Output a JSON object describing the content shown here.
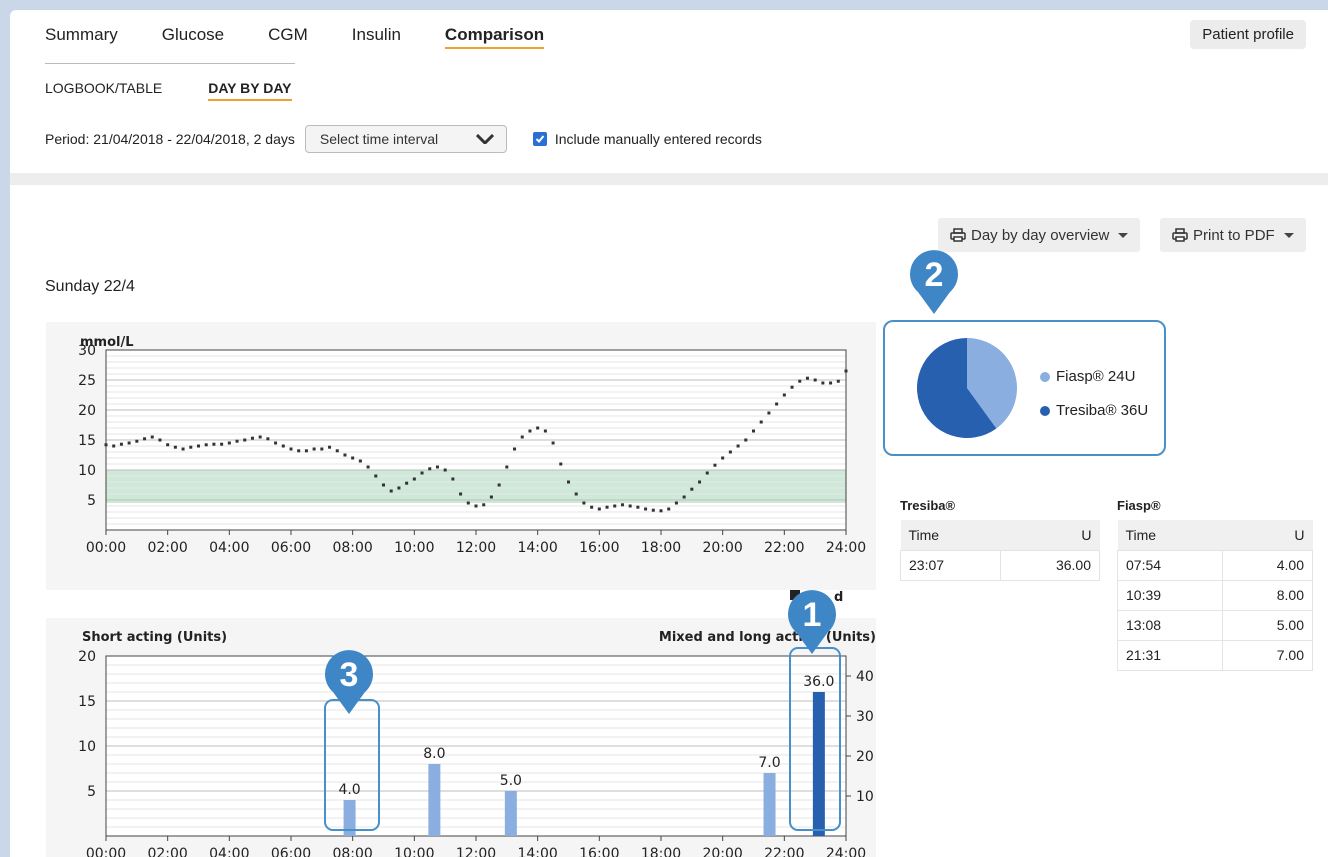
{
  "tabs": [
    "Summary",
    "Glucose",
    "CGM",
    "Insulin",
    "Comparison"
  ],
  "active_tab": "Comparison",
  "patient_profile_label": "Patient profile",
  "subtabs": [
    "LOGBOOK/TABLE",
    "DAY BY DAY"
  ],
  "period_label": "Period: 21/04/2018 - 22/04/2018, 2 days",
  "select_interval_placeholder": "Select time interval",
  "include_manual_label": "Include manually entered records",
  "include_manual_checked": true,
  "overview_button_label": "Day by day overview",
  "print_button_label": "Print to PDF",
  "day_title": "Sunday 22/4",
  "markers": [
    "1",
    "2",
    "3"
  ],
  "pie": {
    "legend": [
      {
        "label": "Fiasp® 24U",
        "value": 24,
        "color": "#8aaee0"
      },
      {
        "label": "Tresiba® 36U",
        "value": 36,
        "color": "#2860b0"
      }
    ]
  },
  "tresiba_table": {
    "title": "Tresiba®",
    "headers": [
      "Time",
      "U"
    ],
    "rows": [
      [
        "23:07",
        "36.00"
      ]
    ]
  },
  "fiasp_table": {
    "title": "Fiasp®",
    "headers": [
      "Time",
      "U"
    ],
    "rows": [
      [
        "07:54",
        "4.00"
      ],
      [
        "10:39",
        "8.00"
      ],
      [
        "13:08",
        "5.00"
      ],
      [
        "21:31",
        "7.00"
      ]
    ]
  },
  "chart_data": [
    {
      "type": "scatter",
      "ylabel": "mmol/L",
      "ylim": [
        0,
        30
      ],
      "yticks": [
        5,
        10,
        15,
        20,
        25,
        30
      ],
      "xticks": [
        "00:00",
        "02:00",
        "04:00",
        "06:00",
        "08:00",
        "10:00",
        "12:00",
        "14:00",
        "16:00",
        "18:00",
        "20:00",
        "22:00",
        "24:00"
      ],
      "target_range": [
        4.5,
        10
      ],
      "colors": {
        "target_band": "#cfe9d8",
        "points": "#333333"
      },
      "legend_fragment": "d",
      "x_hours": [
        0,
        0.25,
        0.5,
        0.75,
        1,
        1.25,
        1.5,
        1.75,
        2,
        2.25,
        2.5,
        2.75,
        3,
        3.25,
        3.5,
        3.75,
        4,
        4.25,
        4.5,
        4.75,
        5,
        5.25,
        5.5,
        5.75,
        6,
        6.25,
        6.5,
        6.75,
        7,
        7.25,
        7.5,
        7.75,
        8,
        8.25,
        8.5,
        8.75,
        9,
        9.25,
        9.5,
        9.75,
        10,
        10.25,
        10.5,
        10.75,
        11,
        11.25,
        11.5,
        11.75,
        12,
        12.25,
        12.5,
        12.75,
        13,
        13.25,
        13.5,
        13.75,
        14,
        14.25,
        14.5,
        14.75,
        15,
        15.25,
        15.5,
        15.75,
        16,
        16.25,
        16.5,
        16.75,
        17,
        17.25,
        17.5,
        17.75,
        18,
        18.25,
        18.5,
        18.75,
        19,
        19.25,
        19.5,
        19.75,
        20,
        20.25,
        20.5,
        20.75,
        21,
        21.25,
        21.5,
        21.75,
        22,
        22.25,
        22.5,
        22.75,
        23,
        23.25,
        23.5,
        23.75,
        24
      ],
      "glucose": [
        14.2,
        14.0,
        14.3,
        14.5,
        14.8,
        15.2,
        15.5,
        15.0,
        14.2,
        13.8,
        13.5,
        13.8,
        14.0,
        14.2,
        14.3,
        14.3,
        14.5,
        14.8,
        15.0,
        15.3,
        15.5,
        15.2,
        14.5,
        14.0,
        13.5,
        13.2,
        13.2,
        13.5,
        13.5,
        13.8,
        13.2,
        12.5,
        12.0,
        11.5,
        10.5,
        9.0,
        7.5,
        6.5,
        7.0,
        7.8,
        8.5,
        9.5,
        10.2,
        10.5,
        10.0,
        8.5,
        6.0,
        4.5,
        4.0,
        4.2,
        5.5,
        7.5,
        10.5,
        13.5,
        15.5,
        16.5,
        17.0,
        16.5,
        14.5,
        11.0,
        8.0,
        6.0,
        4.5,
        3.8,
        3.5,
        3.8,
        4.0,
        4.2,
        4.0,
        3.8,
        3.5,
        3.3,
        3.2,
        3.5,
        4.5,
        5.5,
        6.8,
        8.0,
        9.5,
        10.8,
        12.0,
        13.0,
        14.0,
        15.0,
        16.5,
        18.0,
        19.5,
        21.0,
        22.5,
        23.8,
        24.8,
        25.3,
        25.0,
        24.5,
        24.5,
        24.8,
        26.5
      ]
    },
    {
      "type": "bar",
      "ylabel": "Short acting (Units)",
      "y2label": "Mixed and long acting (Units)",
      "ylim": [
        0,
        20
      ],
      "y2lim": [
        0,
        45
      ],
      "yticks": [
        5,
        10,
        15,
        20
      ],
      "y2ticks": [
        10,
        20,
        30,
        40
      ],
      "xticks": [
        "00:00",
        "02:00",
        "04:00",
        "06:00",
        "08:00",
        "10:00",
        "12:00",
        "14:00",
        "16:00",
        "18:00",
        "20:00",
        "22:00",
        "24:00"
      ],
      "series": [
        {
          "name": "Fiasp®",
          "axis": "left",
          "color": "#8aaee0",
          "x_hours": [
            7.9,
            10.65,
            13.13,
            21.52
          ],
          "values": [
            4.0,
            8.0,
            5.0,
            7.0
          ],
          "labels": [
            "4.0",
            "8.0",
            "5.0",
            "7.0"
          ]
        },
        {
          "name": "Tresiba®",
          "axis": "right",
          "color": "#2860b0",
          "x_hours": [
            23.12
          ],
          "values": [
            36.0
          ],
          "labels": [
            "36.0"
          ]
        }
      ]
    }
  ]
}
